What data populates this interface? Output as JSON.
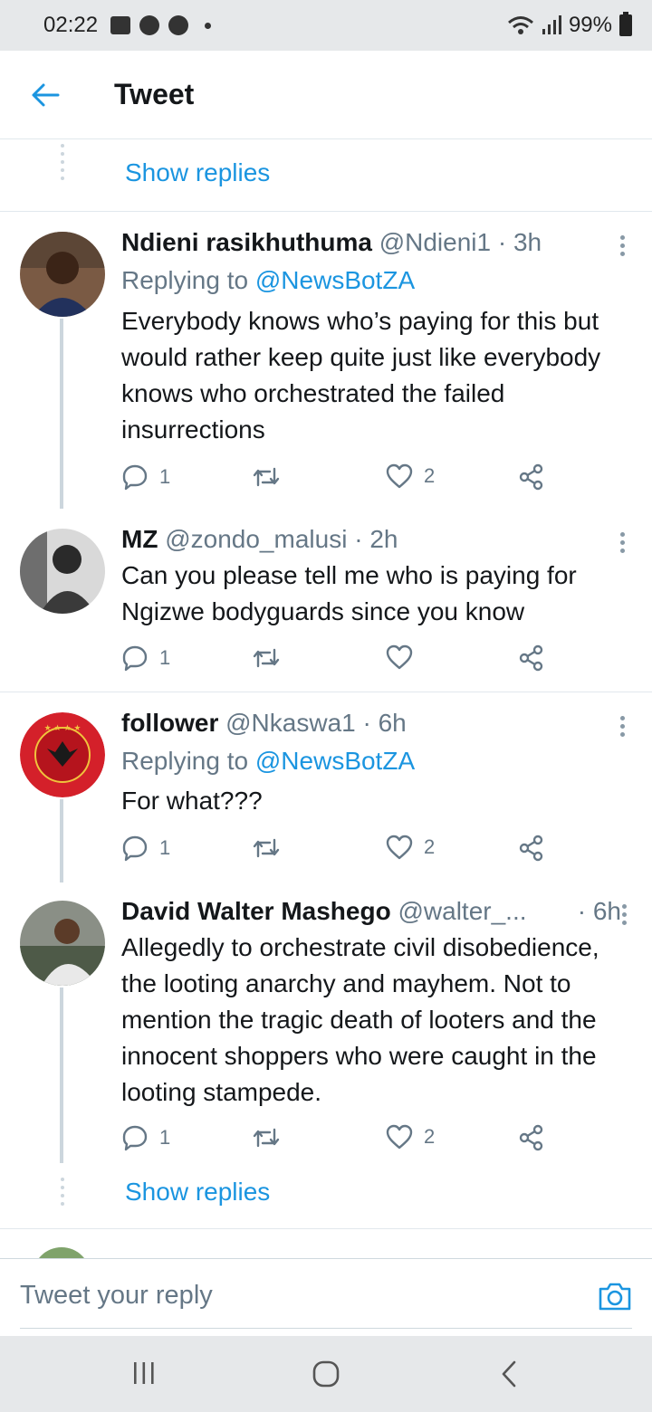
{
  "status_bar": {
    "time": "02:22",
    "battery": "99%"
  },
  "header": {
    "title": "Tweet"
  },
  "show_replies_label": "Show replies",
  "tweets": [
    {
      "name": "Ndieni rasikhuthuma",
      "handle": "@Ndieni1",
      "time": "3h",
      "replying_prefix": "Replying to",
      "replying_to": "@NewsBotZA",
      "text": "Everybody knows who’s paying for this but would rather keep quite just like everybody knows who orchestrated the failed insurrections",
      "replies": "1",
      "retweets": "",
      "likes": "2"
    },
    {
      "name": "MZ",
      "handle": "@zondo_malusi",
      "time": "2h",
      "text": "Can you please tell me who is paying for Ngizwe bodyguards since you know",
      "replies": "1",
      "retweets": "",
      "likes": ""
    },
    {
      "name": "follower",
      "handle": "@Nkaswa1",
      "time": "6h",
      "replying_prefix": "Replying to",
      "replying_to": "@NewsBotZA",
      "text": "For what???",
      "replies": "1",
      "retweets": "",
      "likes": "2"
    },
    {
      "name": "David Walter Mashego",
      "handle": "@walter_...",
      "time": "6h",
      "text": "Allegedly to orchestrate civil disobedience, the looting anarchy and mayhem. Not to mention the tragic death of looters and the innocent shoppers who were caught in the looting stampede.",
      "replies": "1",
      "retweets": "",
      "likes": "2"
    }
  ],
  "reply_bar": {
    "placeholder": "Tweet your reply"
  },
  "colors": {
    "accent": "#1b95e0",
    "secondary_text": "#657786",
    "divider": "#e1e8ed"
  }
}
